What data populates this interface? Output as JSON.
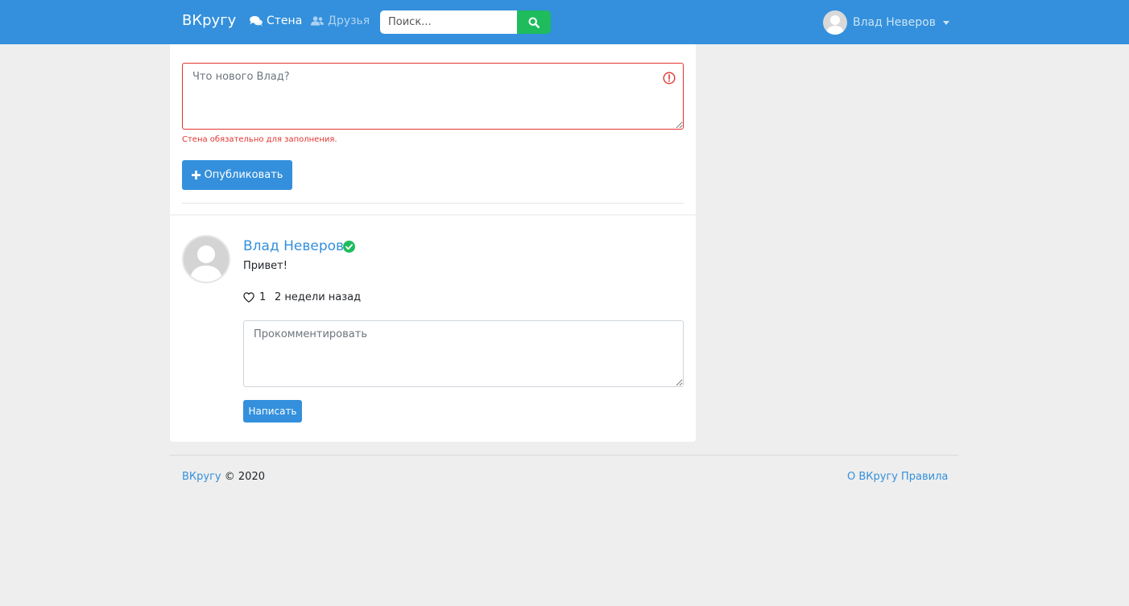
{
  "navbar": {
    "brand": "ВКругу",
    "wall_label": "Стена",
    "friends_label": "Друзья",
    "search_placeholder": "Поиск...",
    "user_name": "Влад Неверов"
  },
  "composer": {
    "placeholder": "Что нового Влад?",
    "error": "Стена обязательно для заполнения.",
    "publish_label": "Опубликовать"
  },
  "post": {
    "author": "Влад Неверов",
    "text": "Привет!",
    "likes": "1",
    "time": "2 недели назад",
    "comment_placeholder": "Прокомментировать",
    "write_label": "Написать"
  },
  "footer": {
    "brand": "ВКругу",
    "copyright": "© 2020",
    "about": "О ВКругу",
    "rules": "Правила"
  },
  "colors": {
    "primary": "#3490dc",
    "success": "#1ebc5d",
    "danger": "#e3342f",
    "background": "#eeeeee"
  },
  "icons": {
    "wall": "comments-icon",
    "friends": "users-icon",
    "search": "search-icon",
    "publish": "plus-icon",
    "invalid": "exclamation-circle-icon",
    "verified": "check-circle-icon",
    "like": "heart-icon"
  }
}
